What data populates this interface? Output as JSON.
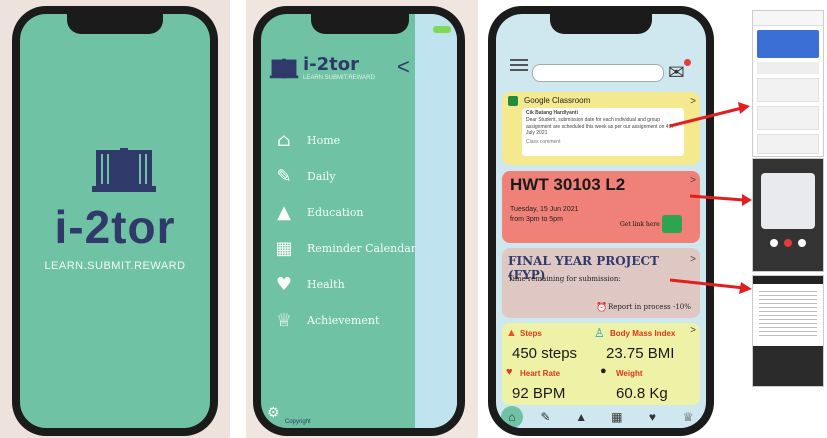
{
  "phone1": {
    "brand": "i-2tor",
    "tagline": "LEARN.SUBMIT.REWARD"
  },
  "phone2": {
    "app_title": "i-2tor",
    "app_subtitle": "LEARN.SUBMIT.REWARD",
    "back": "<",
    "menu": [
      {
        "label": "Home",
        "icon": "home-icon"
      },
      {
        "label": "Daily",
        "icon": "edit-icon"
      },
      {
        "label": "Education",
        "icon": "graduation-cap-icon"
      },
      {
        "label": "Reminder Calendar",
        "icon": "calendar-icon"
      },
      {
        "label": "Health",
        "icon": "stethoscope-icon"
      },
      {
        "label": "Achievement",
        "icon": "trophy-icon"
      }
    ],
    "copyright": "Copyright"
  },
  "phone3": {
    "classroom": {
      "title": "Google Classroom",
      "author": "Cik Batang Hardiyanti",
      "body": "Dear Student, submission date for each individual and group assignment are scheduled this week as per our assignment on 4th July 2021",
      "comment": "Class comment"
    },
    "hwt": {
      "title": "HWT 30103 L2",
      "date": "Tuesday, 15 Jun 2021",
      "time": "from 3pm to 5pm",
      "link": "Get link here"
    },
    "fyp": {
      "title": "FINAL YEAR PROJECT (FYP)",
      "subtitle": "Time remaining for submission:",
      "report": "Report in process -10%"
    },
    "health": {
      "steps_label": "Steps",
      "steps_value": "450 steps",
      "bmi_label": "Body Mass Index",
      "bmi_value": "23.75 BMI",
      "hr_label": "Heart Rate",
      "hr_value": "92 BPM",
      "weight_label": "Weight",
      "weight_value": "60.8 Kg"
    },
    "tabs": [
      "home-icon",
      "edit-icon",
      "graduation-cap-icon",
      "calendar-icon",
      "stethoscope-icon",
      "trophy-icon"
    ]
  },
  "colors": {
    "mint": "#6fc2a3",
    "navy": "#2f3a6b",
    "arrow": "#e02020"
  }
}
